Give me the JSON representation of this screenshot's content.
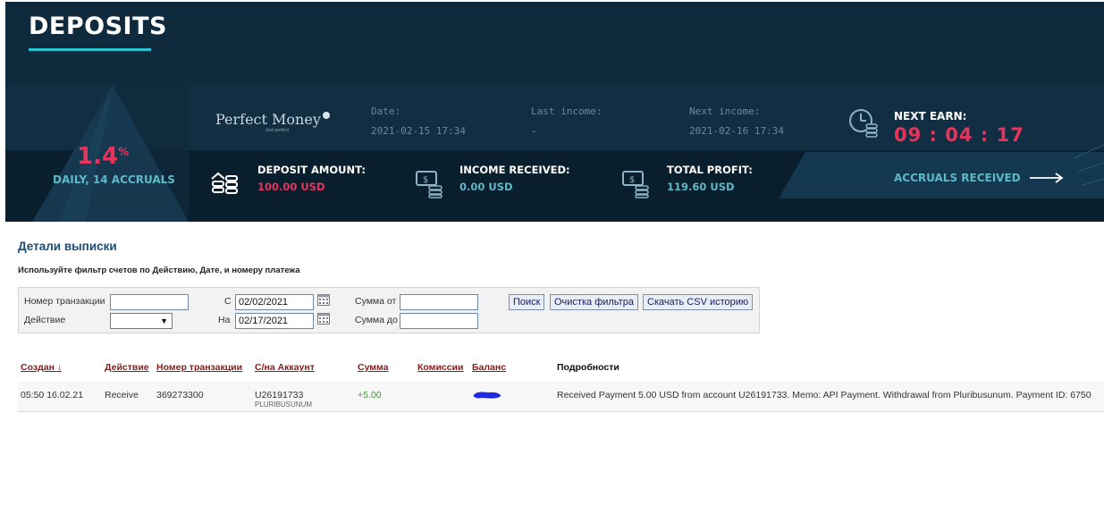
{
  "banner": {
    "title": "DEPOSITS",
    "rate": "1.4",
    "rate_unit": "%",
    "rate_sub": "DAILY, 14 ACCRUALS",
    "payment_system": "Perfect Money",
    "payment_system_tag": "Just perfect",
    "date_label": "Date:",
    "date_value": "2021-02-15 17:34",
    "last_income_label": "Last income:",
    "last_income_value": "-",
    "next_income_label": "Next income:",
    "next_income_value": "2021-02-16 17:34",
    "next_earn_label": "NEXT EARN:",
    "next_earn_value": "09 : 04 : 17",
    "deposit_amount_label": "DEPOSIT AMOUNT:",
    "deposit_amount_value": "100.00 USD",
    "income_received_label": "INCOME RECEIVED:",
    "income_received_value": "0.00 USD",
    "total_profit_label": "TOTAL PROFIT:",
    "total_profit_value": "119.60 USD",
    "accruals_label": "ACCRUALS RECEIVED",
    "accent_color": "#e8345c",
    "teal_color": "#5fb8c9"
  },
  "statement": {
    "title": "Детали выписки",
    "subtitle": "Используйте фильтр счетов по Действию, Дате, и номеру платежа"
  },
  "filter": {
    "txn_label": "Номер транзакции",
    "txn_value": "",
    "action_label": "Действие",
    "action_value": "",
    "from_label": "С",
    "from_value": "02/02/2021",
    "to_label": "На",
    "to_value": "02/17/2021",
    "sum_from_label": "Сумма от",
    "sum_from_value": "",
    "sum_to_label": "Сумма до",
    "sum_to_value": "",
    "search_button": "Поиск",
    "clear_button": "Очистка фильтра",
    "csv_button": "Скачать CSV историю"
  },
  "table": {
    "headers": {
      "created": "Создан ↓",
      "action": "Действие",
      "txn": "Номер транзакции",
      "account": "С/на Аккаунт",
      "amount": "Сумма",
      "fee": "Комиссии",
      "balance": "Баланс",
      "details": "Подробности"
    },
    "rows": [
      {
        "created": "05:50 16.02.21",
        "action": "Receive",
        "txn": "369273300",
        "account": "U26191733",
        "account_name": "PLURIBUSUNUM",
        "amount": "+5.00",
        "fee": "",
        "balance": "",
        "details": "Received Payment 5.00 USD from account U26191733. Memo: API Payment. Withdrawal from Pluribusunum. Payment ID: 6750"
      }
    ]
  }
}
